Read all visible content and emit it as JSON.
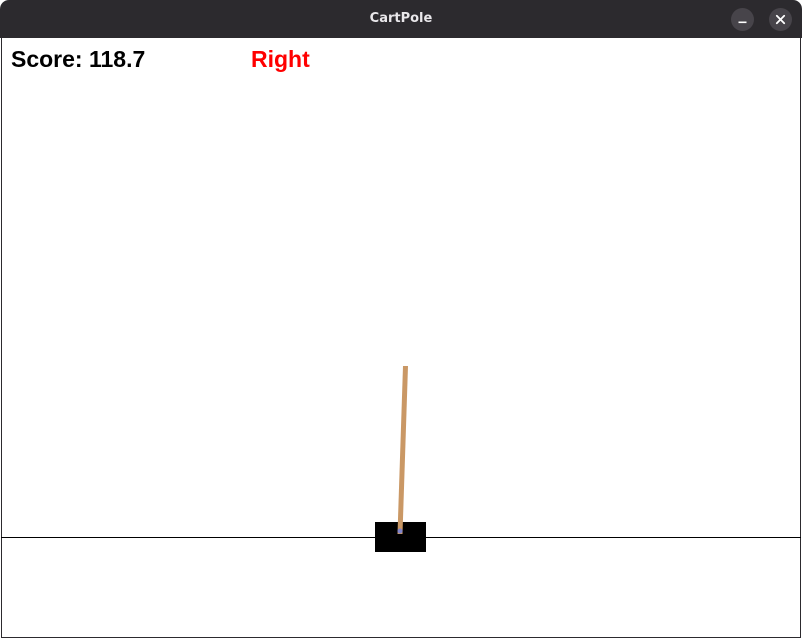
{
  "window": {
    "title": "CartPole",
    "minimize_icon": "minimize-icon",
    "close_icon": "close-icon"
  },
  "hud": {
    "score_text": "Score: 118.7",
    "action_text": "Right",
    "action_color": "#ff0000"
  },
  "scene": {
    "background_color": "#ffffff",
    "track_color": "#000000",
    "cart_color": "#000000",
    "pole_color": "#ca9865",
    "axle_color": "#8184cb"
  }
}
